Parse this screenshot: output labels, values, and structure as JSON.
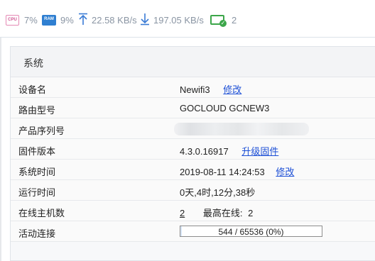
{
  "status": {
    "cpu_icon_text": "CPU",
    "cpu": "7%",
    "ram_icon_text": "RAM",
    "ram": "9%",
    "upload": "22.58 KB/s",
    "download": "197.05 KB/s",
    "devices": "2",
    "colors": {
      "cpu": "#e58ab5",
      "ram": "#2f7fd1",
      "arrows": "#3a7bd5",
      "devices": "#3ca64a"
    }
  },
  "panel": {
    "title": "系统",
    "rows": {
      "device_name": {
        "label": "设备名",
        "value": "Newifi3",
        "action": "修改"
      },
      "model": {
        "label": "路由型号",
        "value": "GOCLOUD GCNEW3"
      },
      "serial": {
        "label": "产品序列号"
      },
      "firmware": {
        "label": "固件版本",
        "value": "4.3.0.16917",
        "action": "升级固件"
      },
      "system_time": {
        "label": "系统时间",
        "value": "2019-08-11 14:24:53",
        "action": "修改"
      },
      "uptime": {
        "label": "运行时间",
        "value": "0天,4时,12分,38秒"
      },
      "online_hosts": {
        "label": "在线主机数",
        "value": "2",
        "peak_label": "最高在线:",
        "peak_value": "2"
      },
      "connections": {
        "label": "活动连接",
        "value": "544 / 65536 (0%)",
        "fraction": 0.0083
      }
    }
  }
}
